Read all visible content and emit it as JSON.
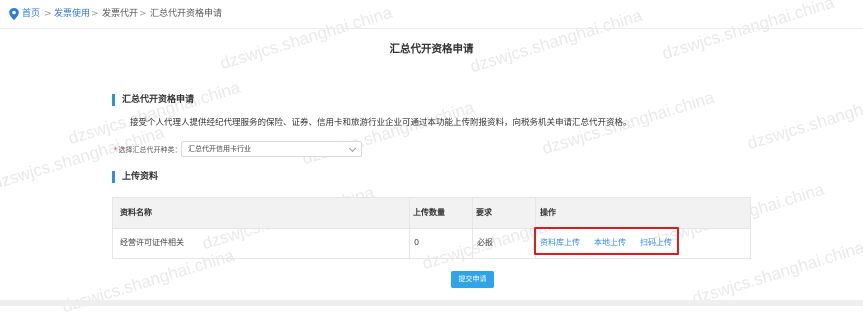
{
  "breadcrumb": {
    "home": "首页",
    "level1": "发票使用",
    "level2": "发票代开",
    "current": "汇总代开资格申请",
    "separator": ">"
  },
  "page": {
    "title": "汇总代开资格申请"
  },
  "section1": {
    "heading": "汇总代开资格申请",
    "description": "接受个人代理人提供经纪代理服务的保险、证券、信用卡和旅游行业企业可通过本功能上传附报资料，向税务机关申请汇总代开资格。",
    "type_label": "选择汇总代开种类：",
    "required_mark": "*",
    "type_value": "汇总代开信用卡行业"
  },
  "section2": {
    "heading": "上传资料"
  },
  "table": {
    "headers": [
      "资料名称",
      "上传数量",
      "要求",
      "操作"
    ],
    "rows": [
      {
        "name": "经营许可证件相关",
        "count": "0",
        "requirement": "必报",
        "actions": [
          "资料库上传",
          "本地上传",
          "扫码上传"
        ]
      }
    ]
  },
  "submit_label": "提交申请",
  "watermark": "dzswjcs.shanghai.china",
  "colors": {
    "accent": "#2f8fe0",
    "link": "#2f7ad6",
    "highlight": "#e01b1b",
    "button": "#2fa4e7"
  }
}
